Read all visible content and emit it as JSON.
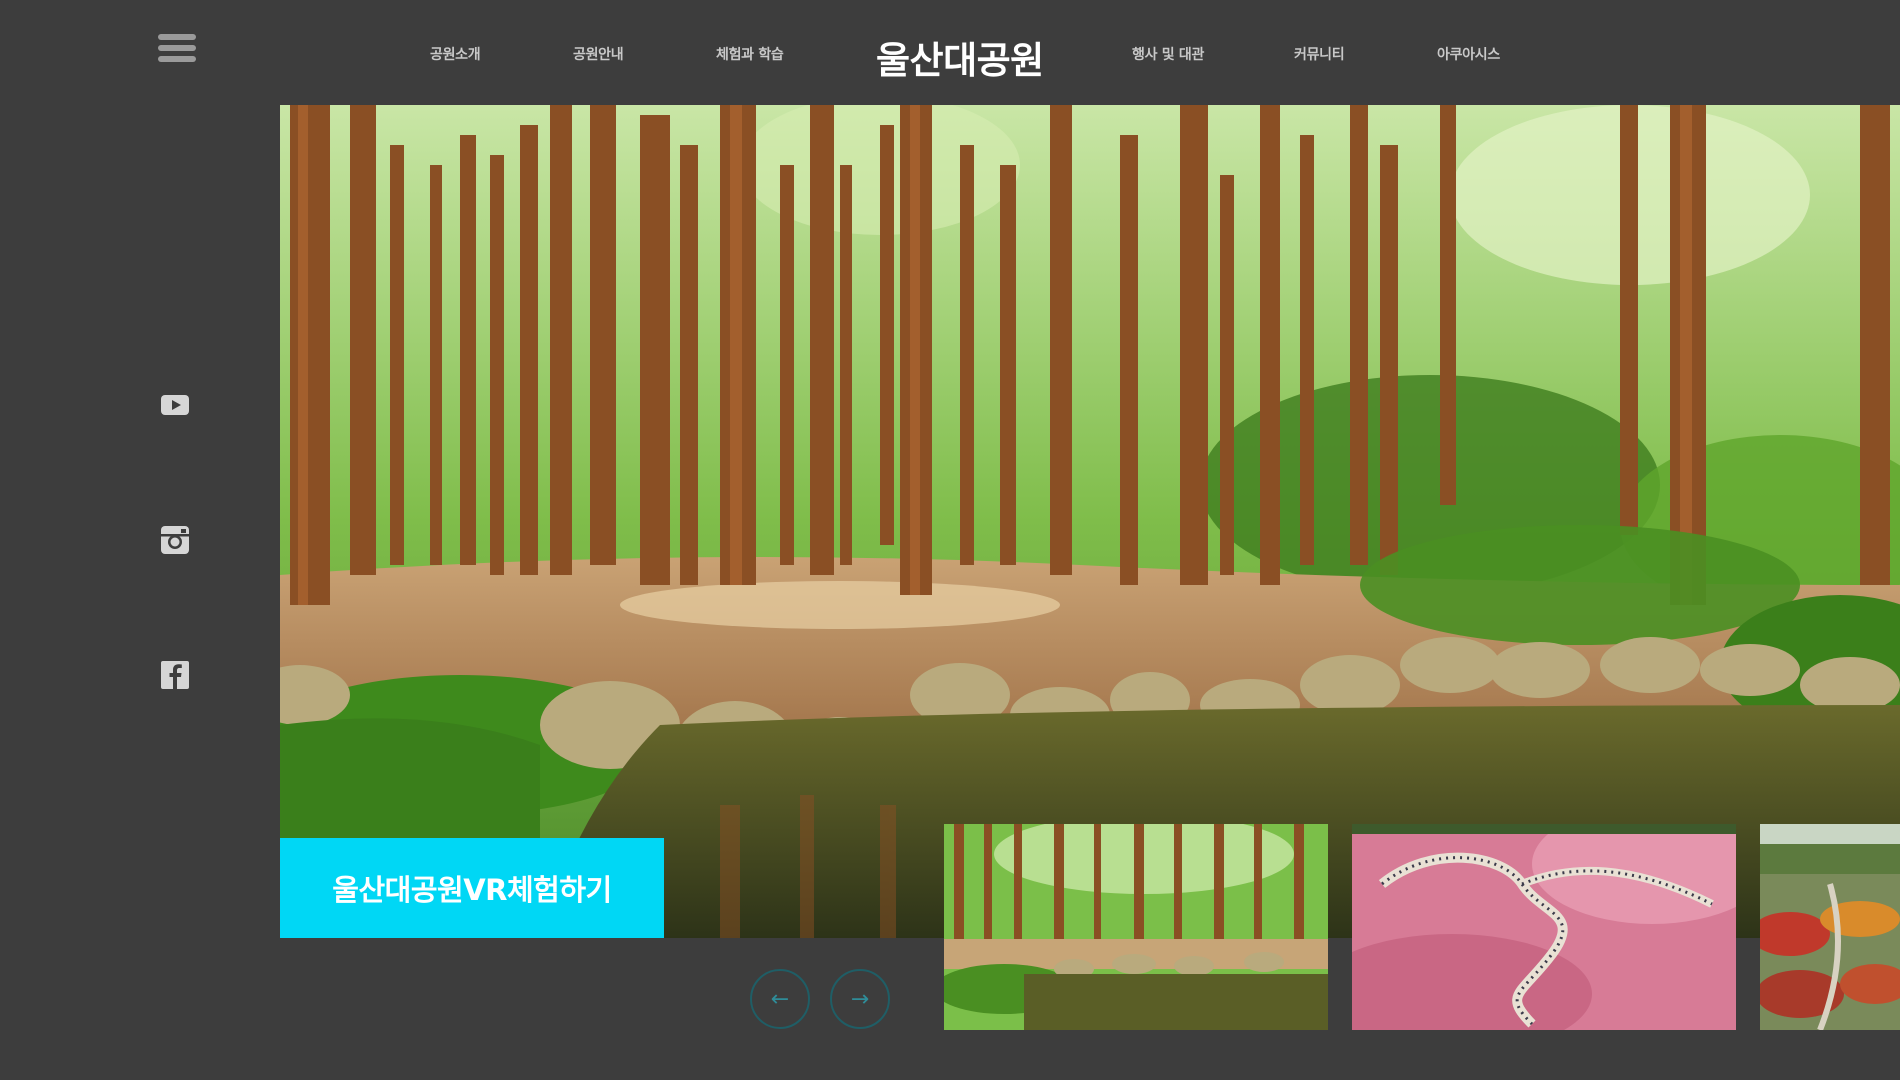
{
  "header": {
    "logo": "울산대공원",
    "nav": [
      "공원소개",
      "공원안내",
      "체험과 학습",
      "행사 및 대관",
      "커뮤니티",
      "아쿠아시스"
    ]
  },
  "social": [
    "youtube-icon",
    "instagram-icon",
    "facebook-icon"
  ],
  "hero": {
    "cta_label": "울산대공원VR체험하기",
    "prev_label": "←",
    "next_label": "→"
  },
  "thumbnails": [
    "forest-pond",
    "pink-muhly-field",
    "flower-garden"
  ],
  "colors": {
    "background": "#3d3d3d",
    "accent": "#00d7f5",
    "nav_text": "#c8c8c8",
    "logo_text": "#ffffff"
  }
}
